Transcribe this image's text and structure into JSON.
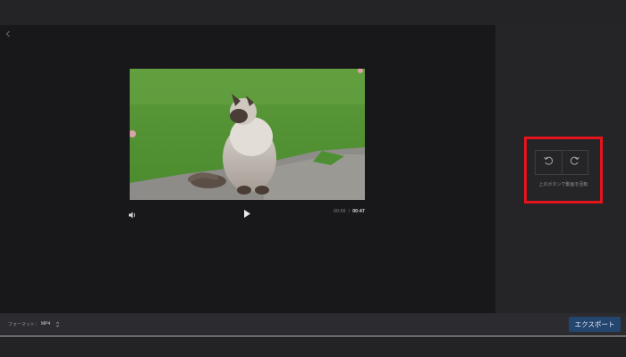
{
  "player": {
    "current_time": "00:00",
    "separator": "/",
    "duration": "00:47"
  },
  "rotate": {
    "hint": "上のボタンで動画を回転"
  },
  "bottom": {
    "format_label": "フォーマット：",
    "format_value": "MP4",
    "export_label": "エクスポート"
  },
  "colors": {
    "highlight": "#e3141b",
    "export_button": "#24456e"
  },
  "icons": {
    "back": "chevron-left-icon",
    "volume": "volume-icon",
    "play": "play-icon",
    "rotate_left": "rotate-ccw-icon",
    "rotate_right": "rotate-cw-icon",
    "select": "updown-chevron-icon"
  }
}
